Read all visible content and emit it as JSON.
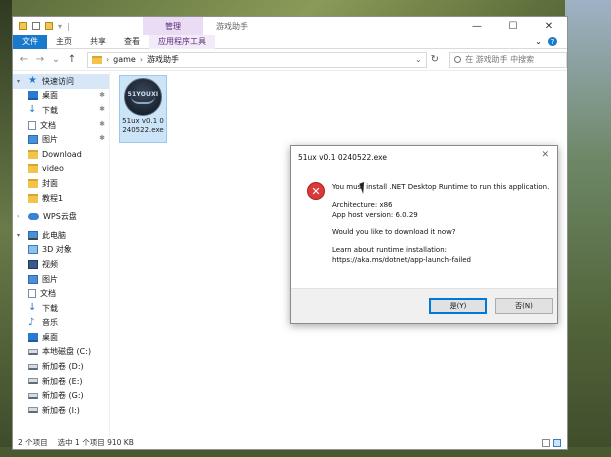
{
  "colors": {
    "accent": "#1979ca",
    "selected_bg": "#cce4f7",
    "context_tab": "#eadcf4",
    "error": "#d83a3a"
  },
  "window": {
    "title": "游戏助手",
    "context_tab": "管理",
    "ribbon_tabs": [
      "文件",
      "主页",
      "共享",
      "查看",
      "应用程序工具"
    ]
  },
  "address": {
    "crumbs": [
      "game",
      "游戏助手"
    ],
    "search_placeholder": "在 游戏助手 中搜索"
  },
  "sidebar": {
    "items": [
      {
        "label": "快速访问",
        "icon": "star-icon"
      },
      {
        "label": "桌面",
        "icon": "desktop-icon"
      },
      {
        "label": "下载",
        "icon": "download-icon"
      },
      {
        "label": "文档",
        "icon": "document-icon"
      },
      {
        "label": "图片",
        "icon": "pictures-icon"
      },
      {
        "label": "Download",
        "icon": "folder-icon"
      },
      {
        "label": "video",
        "icon": "folder-icon"
      },
      {
        "label": "封面",
        "icon": "folder-icon"
      },
      {
        "label": "教程1",
        "icon": "folder-icon"
      },
      {
        "label": "WPS云盘",
        "icon": "cloud-icon"
      },
      {
        "label": "此电脑",
        "icon": "computer-icon"
      },
      {
        "label": "3D 对象",
        "icon": "3d-objects-icon"
      },
      {
        "label": "视频",
        "icon": "video-icon"
      },
      {
        "label": "图片",
        "icon": "pictures-icon"
      },
      {
        "label": "文档",
        "icon": "document-icon"
      },
      {
        "label": "下载",
        "icon": "download-icon"
      },
      {
        "label": "音乐",
        "icon": "music-icon"
      },
      {
        "label": "桌面",
        "icon": "desktop-icon"
      },
      {
        "label": "本地磁盘 (C:)",
        "icon": "drive-icon"
      },
      {
        "label": "新加卷 (D:)",
        "icon": "drive-icon"
      },
      {
        "label": "新加卷 (E:)",
        "icon": "drive-icon"
      },
      {
        "label": "新加卷 (G:)",
        "icon": "drive-icon"
      },
      {
        "label": "新加卷 (I:)",
        "icon": "drive-icon"
      }
    ]
  },
  "files": [
    {
      "name": "51ux v0.1 0240522.exe",
      "icon_text": "51YOUXI"
    }
  ],
  "status": {
    "count": "2 个项目",
    "selection": "选中 1 个项目  910 KB"
  },
  "dialog": {
    "title": "51ux v0.1 0240522.exe",
    "message": "You must install .NET Desktop Runtime to run this application.",
    "architecture": "Architecture: x86",
    "host_version": "App host version: 6.0.29",
    "question": "Would you like to download it now?",
    "learn_label": "Learn about runtime installation:",
    "learn_url": "https://aka.ms/dotnet/app-launch-failed",
    "yes_label": "是(Y)",
    "no_label": "否(N)"
  }
}
